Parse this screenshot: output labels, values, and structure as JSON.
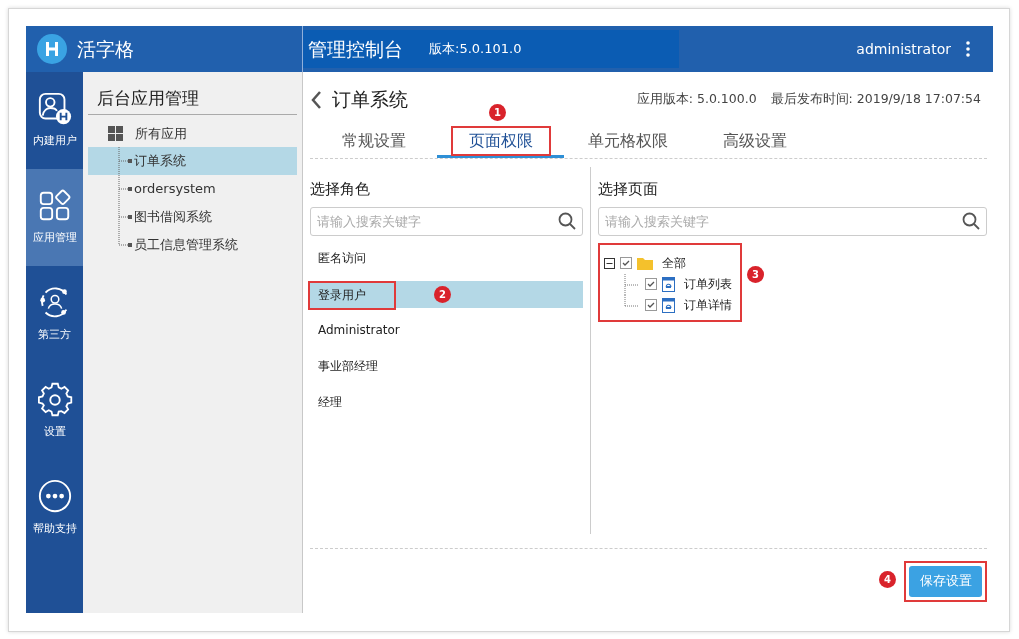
{
  "header": {
    "app_name": "活字格",
    "console_title": "管理控制台",
    "version": "版本:5.0.101.0",
    "user": "administrator"
  },
  "rail": [
    {
      "label": "内建用户",
      "selected": false
    },
    {
      "label": "应用管理",
      "selected": true
    },
    {
      "label": "第三方",
      "selected": false
    },
    {
      "label": "设置",
      "selected": false
    },
    {
      "label": "帮助支持",
      "selected": false
    }
  ],
  "sidebar": {
    "title": "后台应用管理",
    "root": "所有应用",
    "items": [
      {
        "label": "订单系统",
        "selected": true
      },
      {
        "label": "ordersystem",
        "selected": false
      },
      {
        "label": "图书借阅系统",
        "selected": false
      },
      {
        "label": "员工信息管理系统",
        "selected": false
      }
    ]
  },
  "page": {
    "title": "订单系统",
    "app_version": "应用版本: 5.0.100.0",
    "published": "最后发布时间: 2019/9/18 17:07:54"
  },
  "tabs": [
    {
      "label": "常规设置",
      "selected": false
    },
    {
      "label": "页面权限",
      "selected": true,
      "callout": "1"
    },
    {
      "label": "单元格权限",
      "selected": false
    },
    {
      "label": "高级设置",
      "selected": false
    }
  ],
  "roles": {
    "title": "选择角色",
    "placeholder": "请输入搜索关键字",
    "items": [
      {
        "label": "匿名访问",
        "selected": false
      },
      {
        "label": "登录用户",
        "selected": true,
        "callout": "2"
      },
      {
        "label": "Administrator",
        "selected": false
      },
      {
        "label": "事业部经理",
        "selected": false
      },
      {
        "label": "经理",
        "selected": false
      }
    ]
  },
  "pages": {
    "title": "选择页面",
    "placeholder": "请输入搜索关键字",
    "callout": "3",
    "tree": [
      {
        "label": "全部",
        "checked": true,
        "expanded": true,
        "children": [
          {
            "label": "订单列表",
            "checked": true
          },
          {
            "label": "订单详情",
            "checked": true
          }
        ]
      }
    ]
  },
  "save_button": {
    "label": "保存设置",
    "callout": "4"
  }
}
